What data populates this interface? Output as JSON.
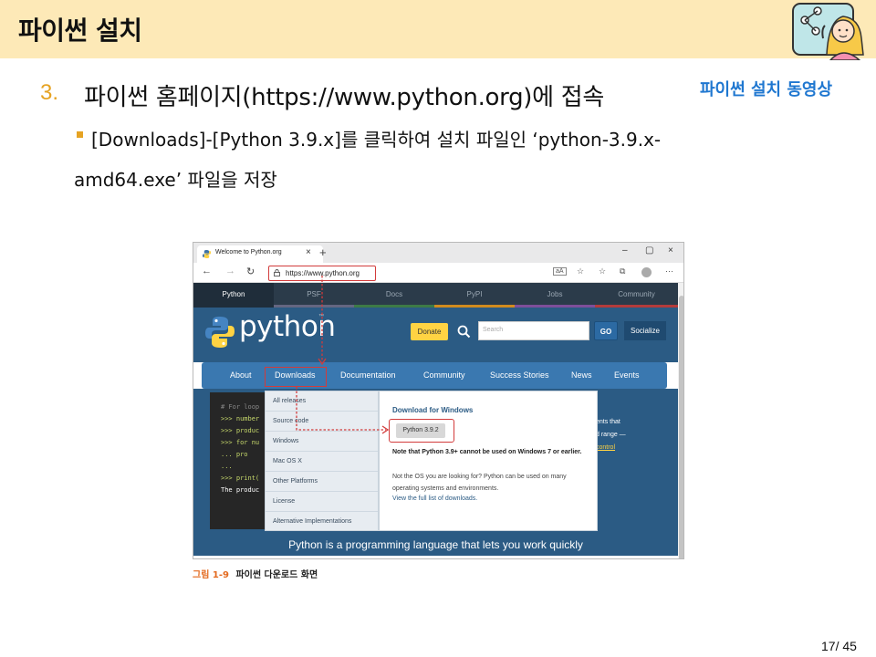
{
  "slide": {
    "title": "파이썬 설치",
    "step_number": "3.",
    "step_text": "파이썬 홈페이지(https://www.python.org)에 접속",
    "video_link": "파이썬 설치 동영상",
    "description_line1": "[Downloads]-[Python 3.9.x]를 클릭하여 설치 파일인 ‘python-3.9.x-",
    "description_line2": "amd64.exe’ 파일을 저장",
    "caption_label": "그림 1-9",
    "caption_text": "파이썬 다운로드 화면",
    "page_number": "17/ 45"
  },
  "browser": {
    "tab_title": "Welcome to Python.org",
    "tab_close": "×",
    "new_tab": "+",
    "window_minimize": "–",
    "window_maximize": "▢",
    "window_close": "×",
    "nav_back": "←",
    "nav_forward": "→",
    "nav_refresh": "↻",
    "url": "https://www.python.org",
    "toolbar_icons": [
      "aA",
      "☆",
      "☆",
      "⧉",
      "⋯"
    ],
    "meta_nav": [
      "Python",
      "PSF",
      "Docs",
      "PyPI",
      "Jobs",
      "Community"
    ],
    "meta_nav_active": "Python"
  },
  "site": {
    "logo_text": "python",
    "trademark": "™",
    "donate": "Donate",
    "search_placeholder": "Search",
    "go": "GO",
    "socialize": "Socialize",
    "main_nav": [
      "About",
      "Downloads",
      "Documentation",
      "Community",
      "Success Stories",
      "News",
      "Events"
    ],
    "code_lines": [
      "# For loop",
      ">>> number",
      ">>> produc",
      ">>> for nu",
      "...     pro",
      "...",
      ">>> print(",
      "The produc"
    ],
    "right_text": [
      "ents that",
      "d range —",
      "control"
    ],
    "downloads_menu": [
      "All releases",
      "Source code",
      "Windows",
      "Mac OS X",
      "Other Platforms",
      "License",
      "Alternative Implementations"
    ],
    "download_title": "Download for Windows",
    "download_version": "Python 3.9.2",
    "download_note": "Note that Python 3.9+ cannot be used on Windows 7 or earlier.",
    "download_sub": "Not the OS you are looking for? Python can be used on many operating systems and environments.",
    "download_link": "View the full list of downloads.",
    "tagline": "Python is a programming language that lets you work quickly"
  },
  "colors": {
    "title_bar": "#fde9b7",
    "step_number": "#e6a323",
    "video_link": "#1f77d0",
    "python_blue": "#2b5b84",
    "donate_yellow": "#ffd343",
    "highlight_red": "#d23b3b"
  },
  "icons": [
    "mascot-icon",
    "python-favicon-icon",
    "lock-icon",
    "search-icon",
    "python-logo-icon"
  ]
}
